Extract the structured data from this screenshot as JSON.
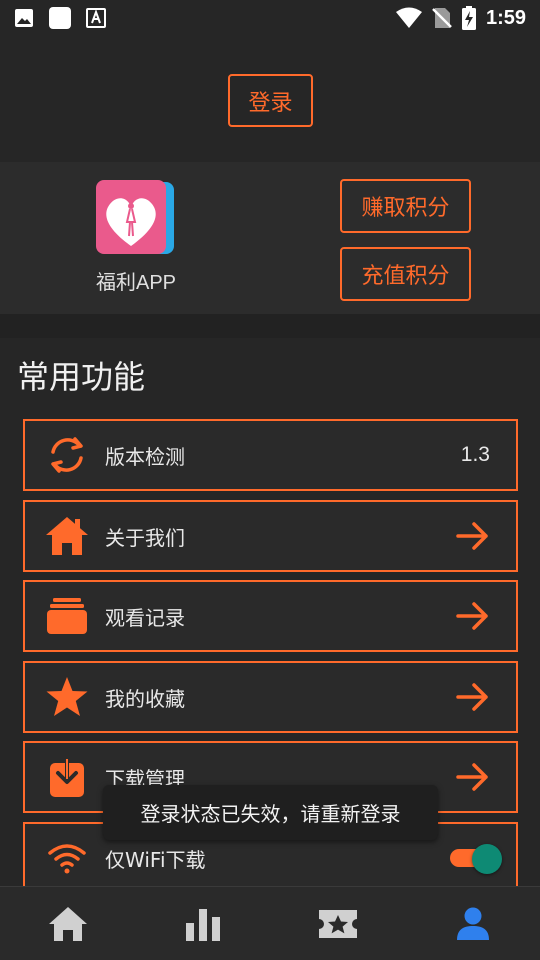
{
  "status_bar": {
    "time": "1:59",
    "icons": [
      "image-icon",
      "square-icon",
      "accessibility-icon",
      "wifi-icon",
      "no-sim-icon",
      "battery-charging-icon"
    ]
  },
  "header": {
    "login_label": "登录"
  },
  "app_card": {
    "app_name": "福利APP",
    "earn_points_label": "赚取积分",
    "recharge_points_label": "充值积分"
  },
  "functions": {
    "title": "常用功能",
    "items": [
      {
        "label": "版本检测",
        "icon": "refresh-icon",
        "value": "1.3"
      },
      {
        "label": "关于我们",
        "icon": "home-icon",
        "right": "arrow-right-icon"
      },
      {
        "label": "观看记录",
        "icon": "history-icon",
        "right": "arrow-right-icon"
      },
      {
        "label": "我的收藏",
        "icon": "star-icon",
        "right": "arrow-right-icon"
      },
      {
        "label": "下载管理",
        "icon": "download-icon",
        "right": "arrow-right-icon"
      },
      {
        "label": "仅WiFi下载",
        "icon": "wifi-icon",
        "toggle_on": true
      }
    ]
  },
  "toast": {
    "message": "登录状态已失效，请重新登录"
  },
  "bottom_nav": {
    "items": [
      {
        "name": "home",
        "icon": "home-icon",
        "active": false
      },
      {
        "name": "stats",
        "icon": "bar-chart-icon",
        "active": false
      },
      {
        "name": "ticket",
        "icon": "ticket-star-icon",
        "active": false
      },
      {
        "name": "profile",
        "icon": "person-icon",
        "active": true
      }
    ]
  },
  "colors": {
    "accent": "#ff6a2b",
    "active_nav": "#2f80ed",
    "toggle_thumb": "#0e8a74",
    "background": "#262626"
  }
}
